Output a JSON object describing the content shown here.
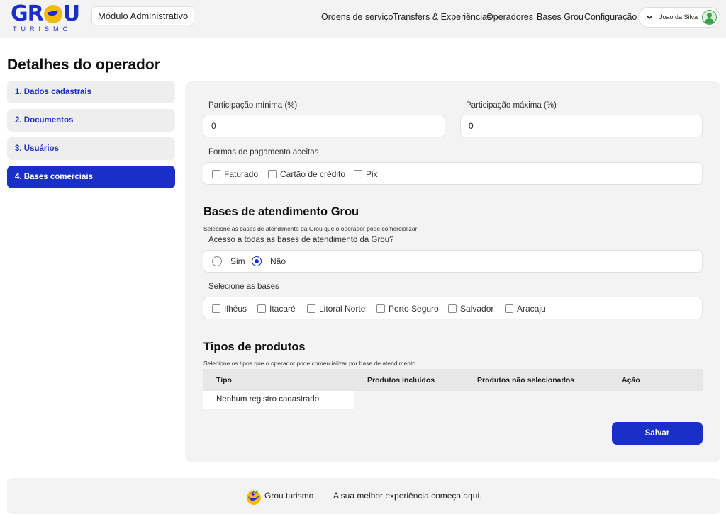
{
  "header": {
    "logo_text": "GROU",
    "logo_subtext": "TURISMO",
    "module": "Módulo Administrativo",
    "nav": [
      "Ordens de serviço",
      "Transfers & Experiências",
      "Operadores",
      "Bases Grou",
      "Configuração"
    ],
    "user": "Joao da Silva"
  },
  "page": {
    "title": "Detalhes do operador"
  },
  "sidebar": {
    "items": [
      {
        "label": "1. Dados cadastrais",
        "active": false
      },
      {
        "label": "2. Documentos",
        "active": false
      },
      {
        "label": "3. Usuários",
        "active": false
      },
      {
        "label": "4. Bases comerciais",
        "active": true
      }
    ]
  },
  "form": {
    "min_label": "Participação mínima (%)",
    "min_value": "0",
    "max_label": "Participação máxima (%)",
    "max_value": "0",
    "payment_label": "Formas de pagamento aceitas",
    "payment_options": [
      "Faturado",
      "Cartão de crédito",
      "Pix"
    ]
  },
  "bases": {
    "title": "Bases de atendimento Grou",
    "subtitle": "Selecione as bases de atendimento da Grou que o operador pode comercializar",
    "access_label": "Acesso a todas as bases de atendimento da Grou?",
    "access_options": [
      "Sim",
      "Não"
    ],
    "access_selected": "Não",
    "select_label": "Selecione as bases",
    "options": [
      "Ilhéus",
      "Itacaré",
      "Litoral Norte",
      "Porto Seguro",
      "Salvador",
      "Aracaju"
    ]
  },
  "products": {
    "title": "Tipos de produtos",
    "subtitle": "Selecione os tipos que o operador pode comercializar por base de atendimento",
    "columns": [
      "Tipo",
      "Produtos incluídos",
      "Produtos não selecionados",
      "Ação"
    ],
    "empty": "Nenhum registro cadastrado"
  },
  "actions": {
    "save": "Salvar"
  },
  "footer": {
    "brand": "Grou turismo",
    "tagline": "A sua melhor experiência começa aqui."
  },
  "colors": {
    "primary": "#1a2fc8",
    "accent": "#f2b90f",
    "panel": "#f3f3f3"
  }
}
